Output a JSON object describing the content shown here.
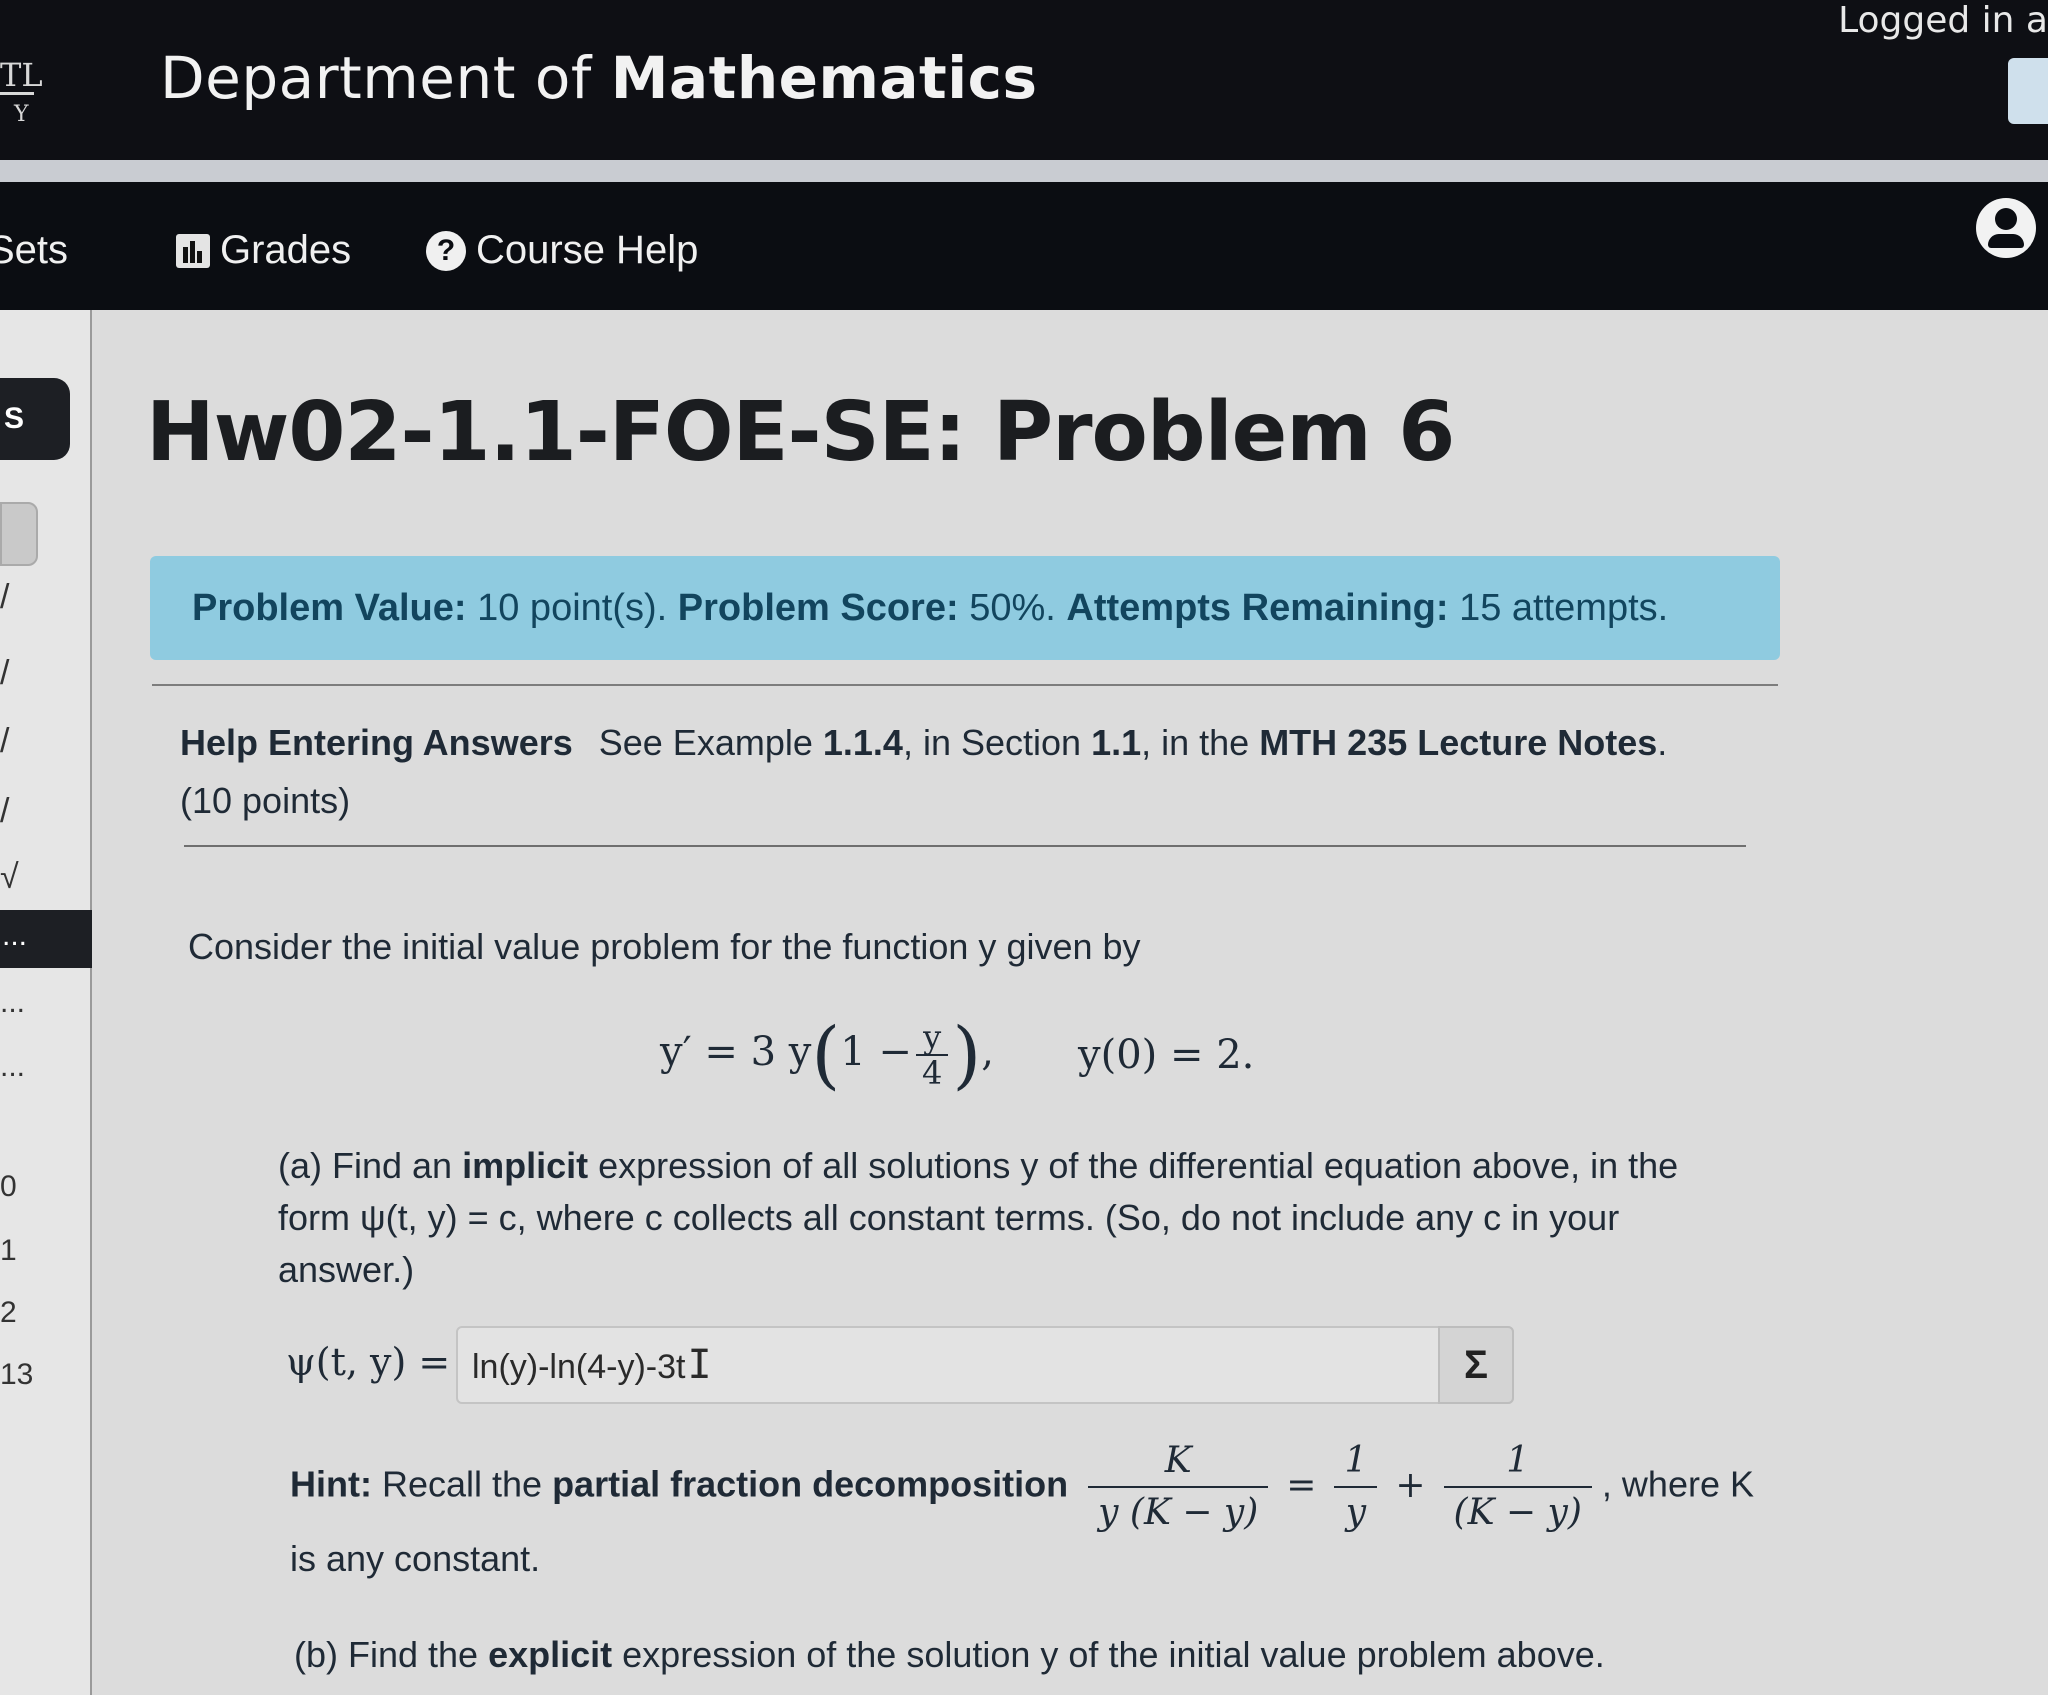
{
  "header": {
    "logo_top": "TL",
    "logo_bottom": "Y",
    "dept_prefix": "Department of ",
    "dept_bold": "Mathematics",
    "logged_in_text": "Logged in a"
  },
  "nav": {
    "sets_label": "Sets",
    "grades_label": "Grades",
    "help_label": "Course Help"
  },
  "sidebar": {
    "active_item": "S",
    "marks": [
      "/",
      "/",
      "/",
      "/",
      "√"
    ],
    "dark_item": "...",
    "dots": [
      "...",
      "..."
    ],
    "numbers": [
      "0",
      "1",
      "2",
      "13"
    ]
  },
  "problem": {
    "title": "Hw02-1.1-FOE-SE: Problem 6",
    "value_label": "Problem Value:",
    "value": "10 point(s).",
    "score_label": "Problem Score:",
    "score": "50%.",
    "attempts_label": "Attempts Remaining:",
    "attempts": "15 attempts.",
    "help_link": "Help Entering Answers",
    "see_pre": "See Example ",
    "see_example": "1.1.4",
    "see_mid": ", in Section ",
    "see_section": "1.1",
    "see_mid2": ", in the ",
    "see_notes": "MTH 235 Lecture Notes",
    "see_end": ".",
    "points": "(10 points)",
    "intro": "Consider the initial value problem for the function y given by",
    "eq_lhs": "y′ = 3 y",
    "eq_one": "1 −",
    "eq_frac_num": "y",
    "eq_frac_den": "4",
    "eq_comma": ",",
    "eq_ic": "y(0) = 2.",
    "part_a_pre": "(a) Find an ",
    "part_a_bold": "implicit",
    "part_a_rest": " expression of all solutions y of the differential equation above, in the form ψ(t, y) = c, where c collects all constant terms. (So, do not include any c in your answer.)",
    "psi_label": "ψ(t, y) =",
    "answer_value": "ln(y)-ln(4-y)-3t",
    "sigma": "Σ",
    "hint_label": "Hint:",
    "hint_pre": " Recall the ",
    "hint_bold": "partial fraction decomposition",
    "hint_f1_num": "K",
    "hint_f1_den": "y (K − y)",
    "hint_eq": "=",
    "hint_f2_num": "1",
    "hint_f2_den": "y",
    "hint_plus": "+",
    "hint_f3_num": "1",
    "hint_f3_den": "(K − y)",
    "hint_where": ", where K",
    "hint_line2": "is any constant.",
    "part_b_pre": "(b) Find the ",
    "part_b_bold": "explicit",
    "part_b_rest": " expression of the solution y of the initial value problem above."
  }
}
